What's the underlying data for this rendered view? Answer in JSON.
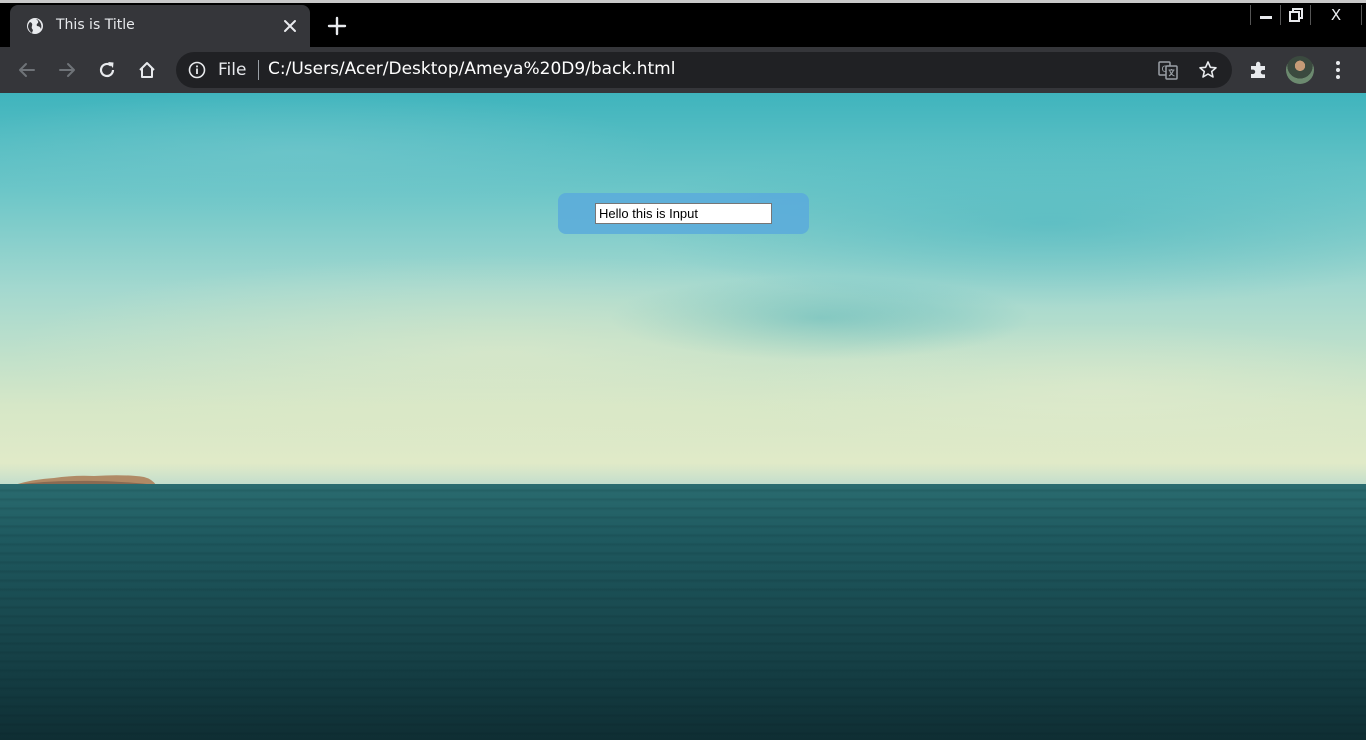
{
  "browser": {
    "tab": {
      "title": "This is Title",
      "favicon": "globe-icon"
    },
    "window_controls": {
      "minimize": "minimize-icon",
      "restore": "restore-icon",
      "close_label": "X"
    },
    "toolbar": {
      "back": "back-arrow-icon",
      "forward": "forward-arrow-icon",
      "reload": "reload-icon",
      "home": "home-icon",
      "scheme_label": "File",
      "url": "C:/Users/Acer/Desktop/Ameya%20D9/back.html",
      "translate": "translate-icon",
      "bookmark": "star-icon",
      "extensions": "puzzle-icon",
      "menu": "more-vert-icon"
    }
  },
  "page": {
    "input": {
      "value": "Hello this is Input"
    }
  },
  "colors": {
    "tab_bg": "#35363a",
    "omnibox_bg": "#202124",
    "panel_bg": "#5aaadc"
  }
}
